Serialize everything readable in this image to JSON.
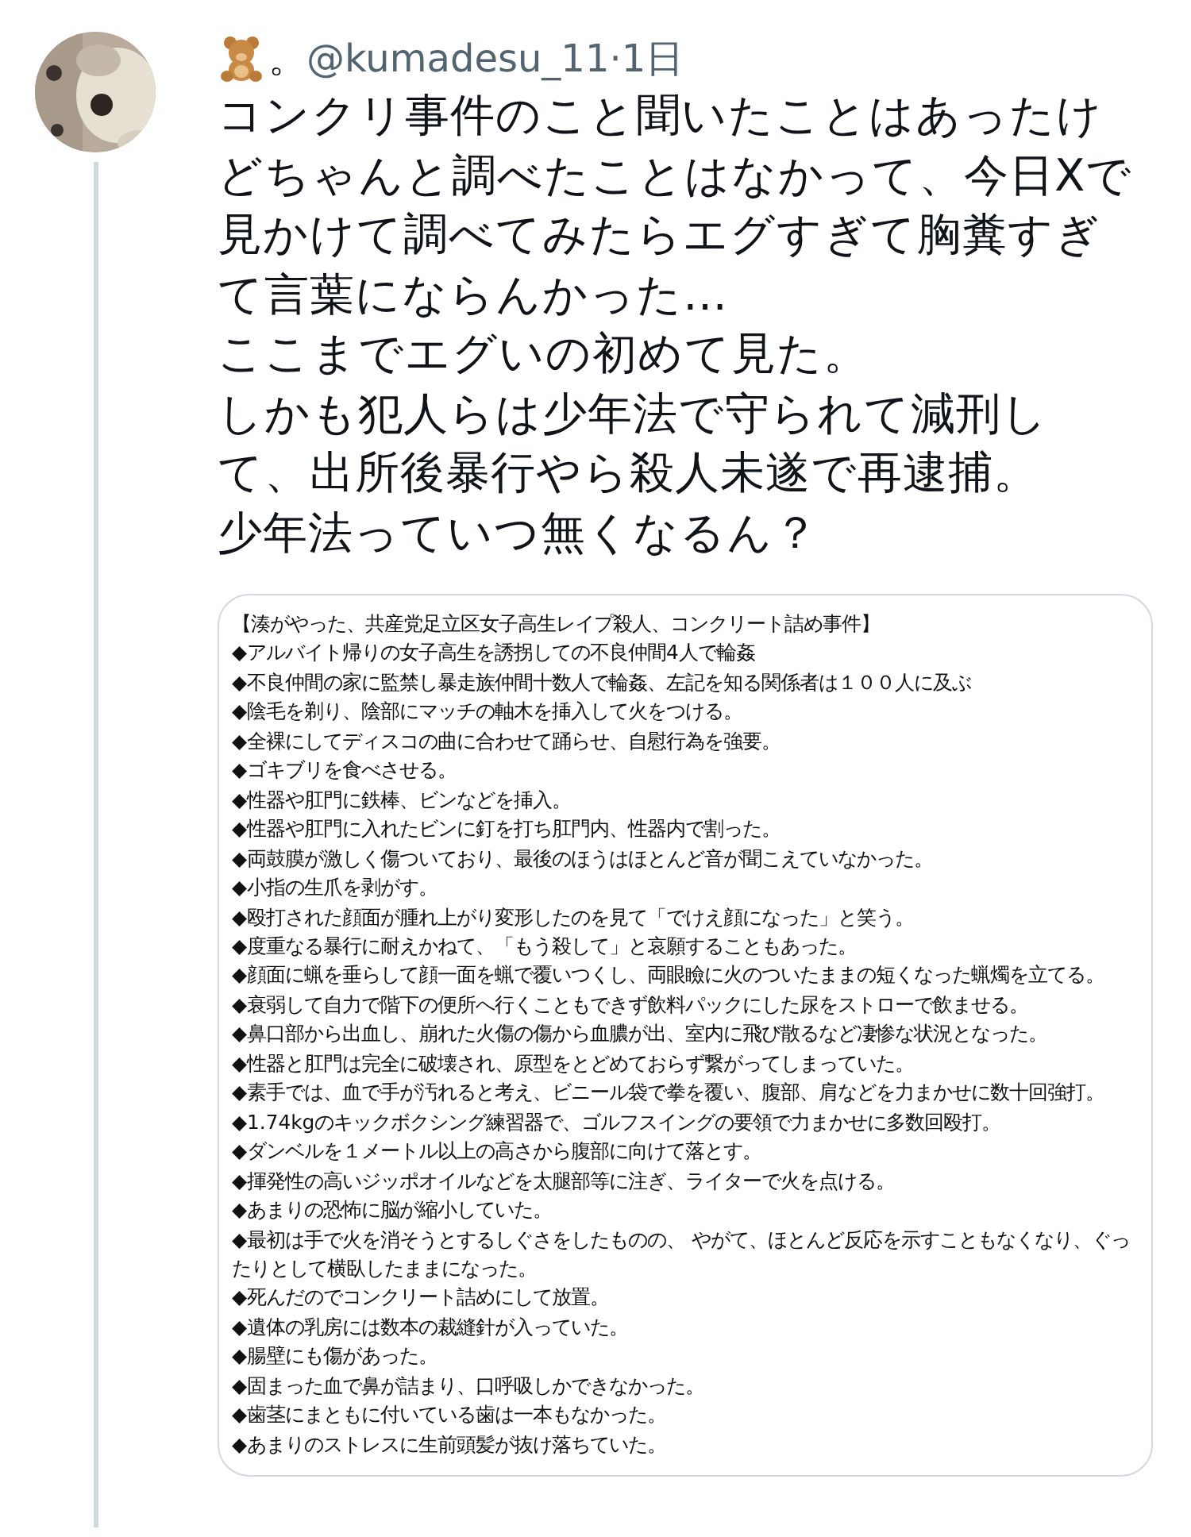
{
  "tweet": {
    "display_name": "。",
    "handle": "@kumadesu_11",
    "separator": "·",
    "time": "1日",
    "text_lines": [
      "コンクリ事件のこと聞いたことはあったけ",
      "どちゃんと調べたことはなかって、今日Xで",
      "見かけて調べてみたらエグすぎて胸糞すぎ",
      "て言葉にならんかった…",
      "ここまでエグいの初めて見た。",
      "しかも犯人らは少年法で守られて減刑し",
      "て、出所後暴行やら殺人未遂で再逮捕。",
      "少年法っていつ無くなるん？"
    ],
    "attached_image": {
      "title": "【湊がやった、共産党足立区女子高生レイプ殺人、コンクリート詰め事件】",
      "items": [
        "◆アルバイト帰りの女子高生を誘拐しての不良仲間4人で輪姦",
        "◆不良仲間の家に監禁し暴走族仲間十数人で輪姦、左記を知る関係者は１００人に及ぶ",
        "◆陰毛を剃り、陰部にマッチの軸木を挿入して火をつける。",
        "◆全裸にしてディスコの曲に合わせて踊らせ、自慰行為を強要。",
        "◆ゴキブリを食べさせる。",
        "◆性器や肛門に鉄棒、ビンなどを挿入。",
        "◆性器や肛門に入れたビンに釘を打ち肛門内、性器内で割った。",
        "◆両鼓膜が激しく傷ついており、最後のほうはほとんど音が聞こえていなかった。",
        "◆小指の生爪を剥がす。",
        "◆殴打された顔面が腫れ上がり変形したのを見て「でけえ顔になった」と笑う。",
        "◆度重なる暴行に耐えかねて、「もう殺して」と哀願することもあった。",
        "◆顔面に蝋を垂らして顔一面を蝋で覆いつくし、両眼瞼に火のついたままの短くなった蝋燭を立てる。",
        "◆衰弱して自力で階下の便所へ行くこともできず飲料パックにした尿をストローで飲ませる。",
        "◆鼻口部から出血し、崩れた火傷の傷から血膿が出、室内に飛び散るなど凄惨な状況となった。",
        "◆性器と肛門は完全に破壊され、原型をとどめておらず繋がってしまっていた。",
        "◆素手では、血で手が汚れると考え、ビニール袋で拳を覆い、腹部、肩などを力まかせに数十回強打。",
        "◆1.74kgのキックボクシング練習器で、ゴルフスイングの要領で力まかせに多数回殴打。",
        "◆ダンベルを１メートル以上の高さから腹部に向けて落とす。",
        "◆揮発性の高いジッポオイルなどを太腿部等に注ぎ、ライターで火を点ける。",
        "◆あまりの恐怖に脳が縮小していた。",
        "◆最初は手で火を消そうとするしぐさをしたものの、 やがて、ほとんど反応を示すこともなくなり、ぐったりとして横臥したままになった。",
        "◆死んだのでコンクリート詰めにして放置。",
        "◆遺体の乳房には数本の裁縫針が入っていた。",
        "◆腸壁にも傷があった。",
        "◆固まった血で鼻が詰まり、口呼吸しかできなかった。",
        "◆歯茎にまともに付いている歯は一本もなかった。",
        "◆あまりのストレスに生前頭髪が抜け落ちていた。"
      ]
    }
  }
}
